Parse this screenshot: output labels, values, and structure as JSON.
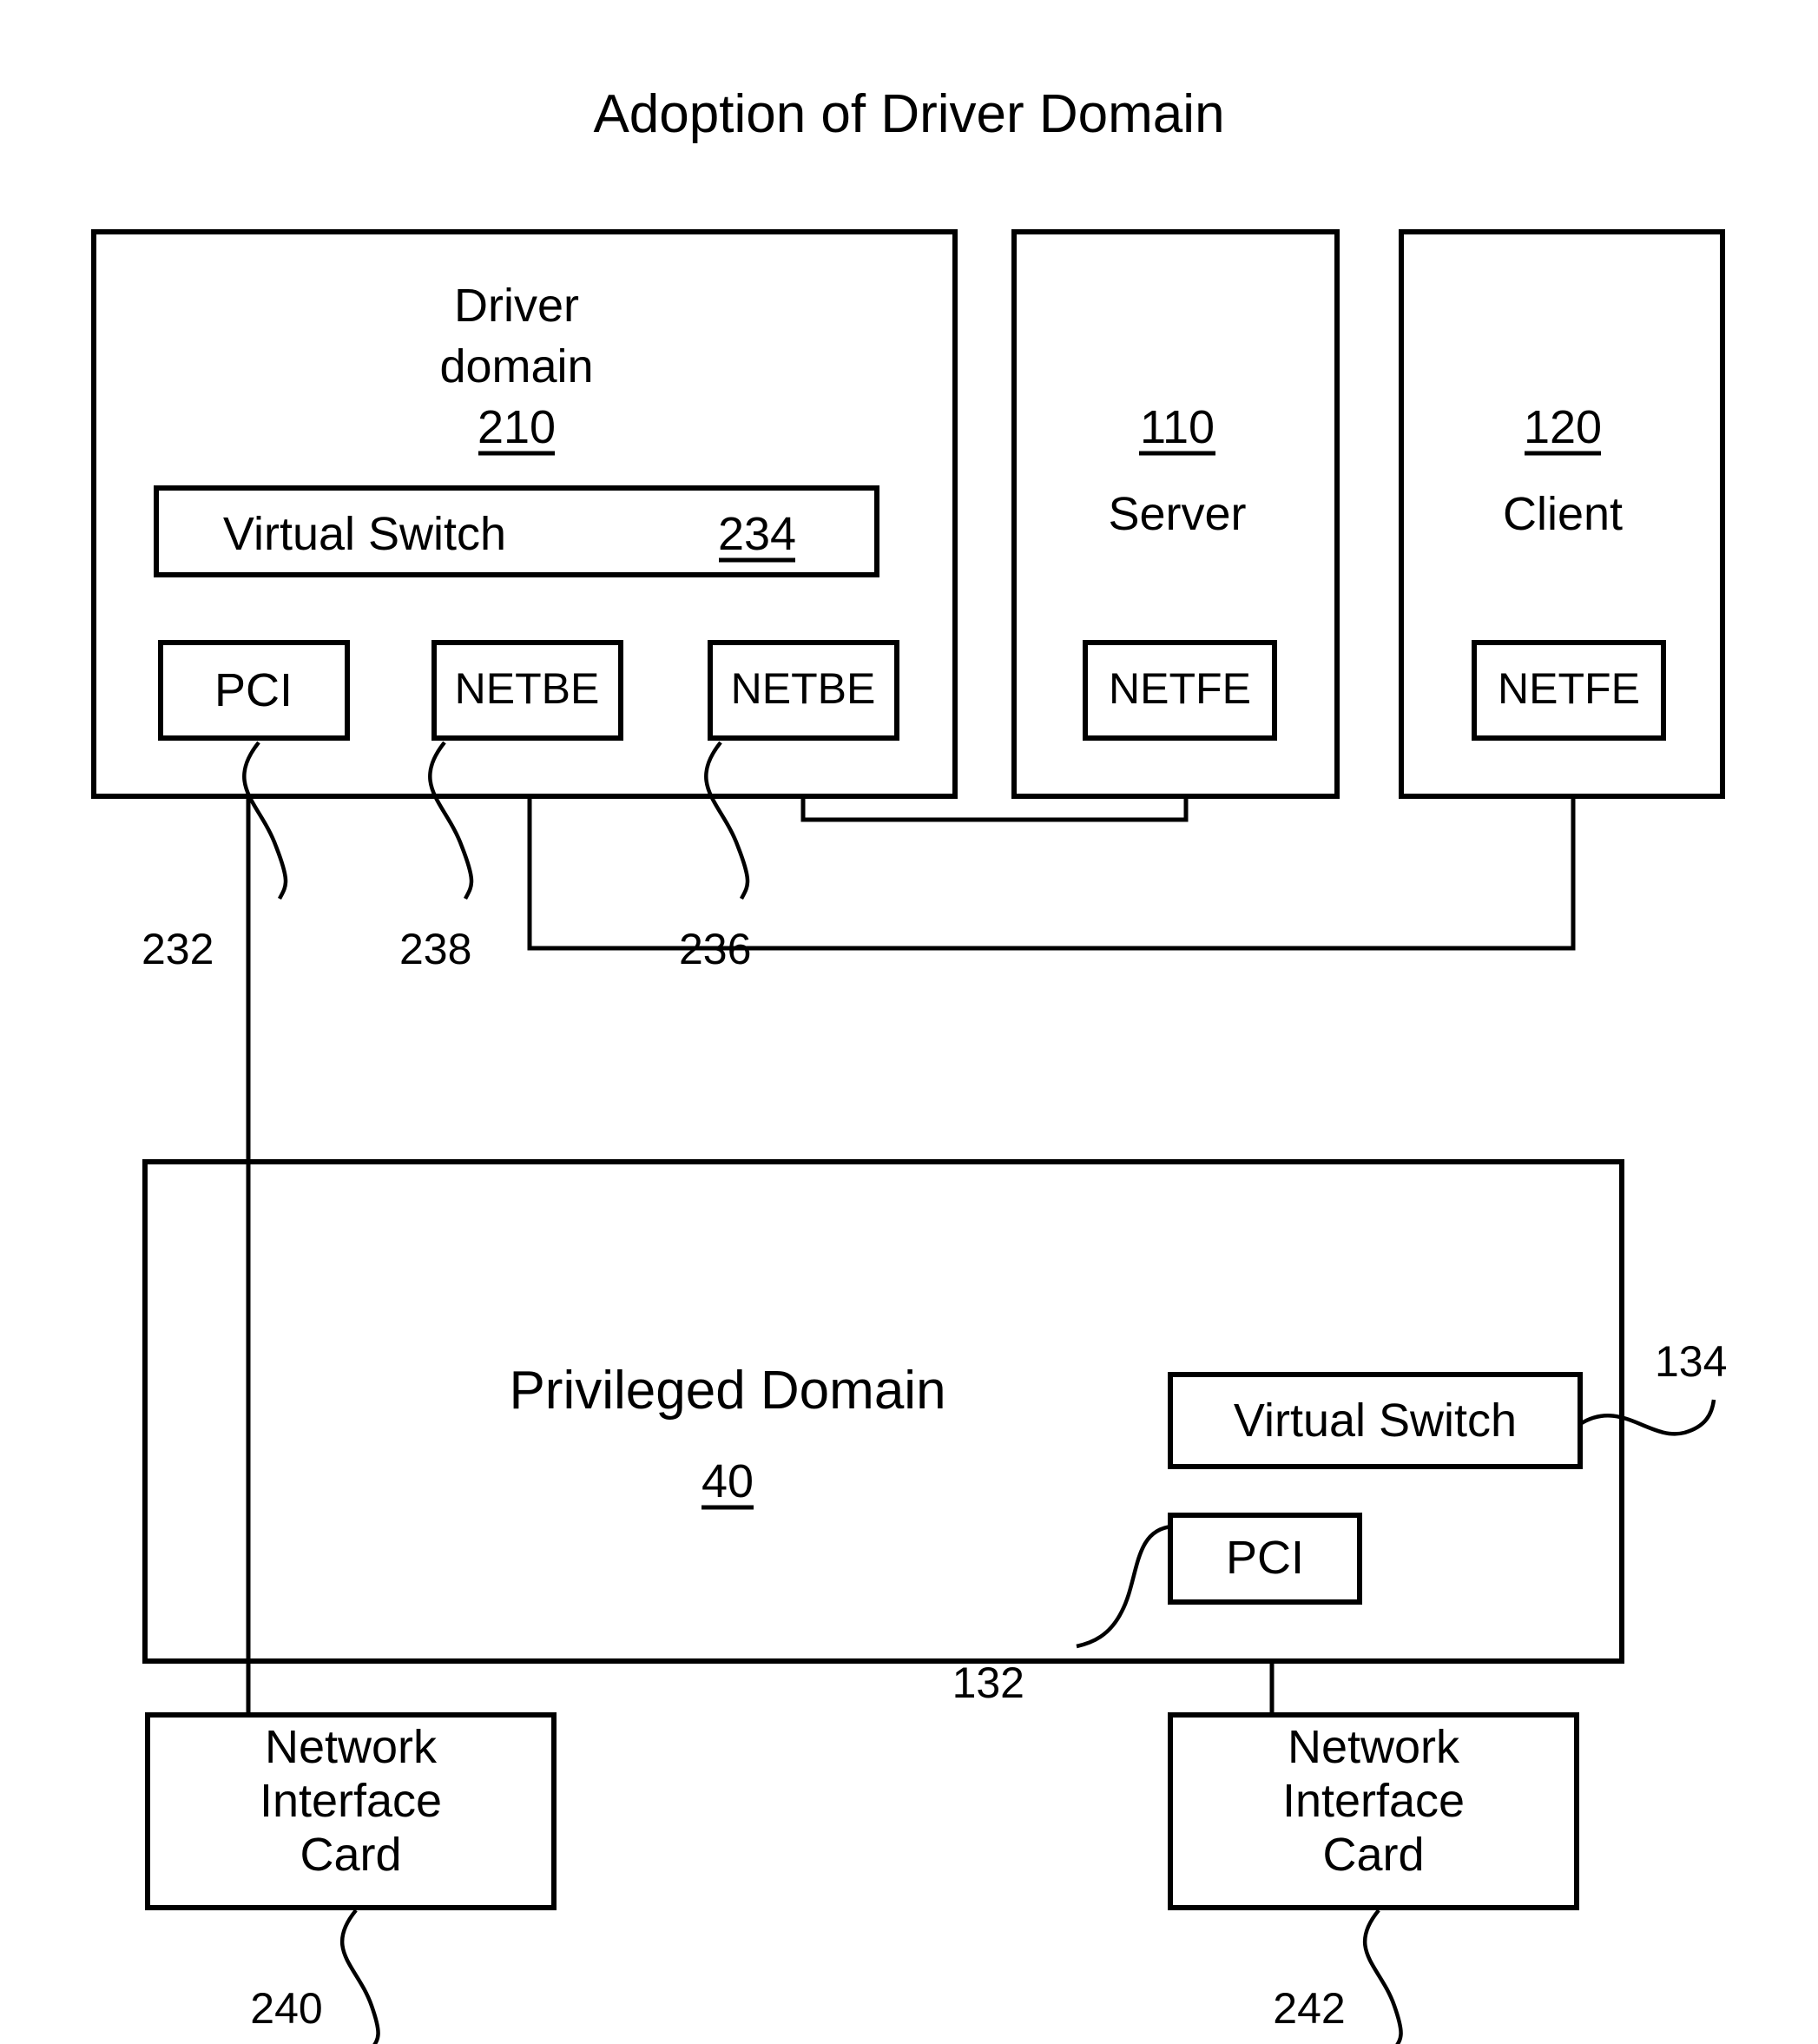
{
  "figure": {
    "title": "Adoption of Driver Domain"
  },
  "driver_domain": {
    "title_line1": "Driver",
    "title_line2": "domain",
    "ref": "210",
    "virtual_switch": {
      "label": "Virtual Switch",
      "ref": "234"
    },
    "components": [
      {
        "label": "PCI",
        "ref": "232"
      },
      {
        "label": "NETBE",
        "ref": "238"
      },
      {
        "label": "NETBE",
        "ref": "236"
      }
    ]
  },
  "server": {
    "ref": "110",
    "label": "Server",
    "netfe_label": "NETFE"
  },
  "client": {
    "ref": "120",
    "label": "Client",
    "netfe_label": "NETFE"
  },
  "privileged_domain": {
    "title": "Privileged Domain",
    "ref": "40",
    "virtual_switch": {
      "label": "Virtual Switch",
      "ref": "134"
    },
    "pci": {
      "label": "PCI",
      "ref": "132"
    }
  },
  "nics": [
    {
      "line1": "Network",
      "line2": "Interface",
      "line3": "Card",
      "ref": "240"
    },
    {
      "line1": "Network",
      "line2": "Interface",
      "line3": "Card",
      "ref": "242"
    }
  ],
  "colors": {
    "stroke": "#000000",
    "background": "#ffffff"
  }
}
